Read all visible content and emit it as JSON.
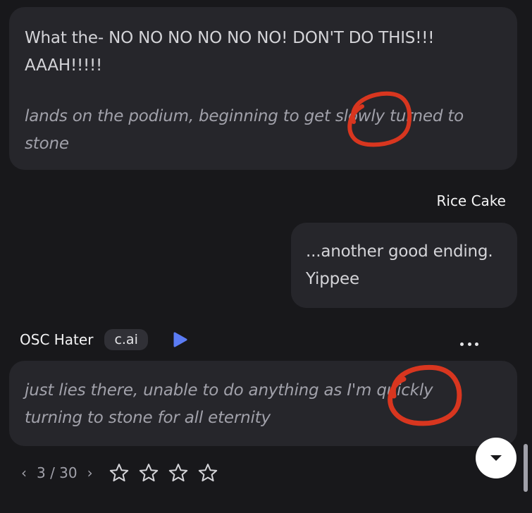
{
  "messages": {
    "first": {
      "line1": "What the- NO NO NO NO NO NO! DON'T DO THIS!!!",
      "line2": "AAAH!!!!!",
      "action_line1": "lands on the podium, beginning to get slowly turned to",
      "action_line2": "stone"
    },
    "user": {
      "name": "Rice Cake",
      "line1": "...another good ending.",
      "line2": "Yippee"
    },
    "character": {
      "name": "OSC Hater",
      "badge": "c.ai",
      "line1": "just lies there, unable to do anything as I'm quickly",
      "line2": "turning to stone for all eternity"
    }
  },
  "pager": {
    "prev": "‹",
    "count": "3 / 30",
    "next": "›"
  },
  "rating": {
    "stars": 4,
    "filled": 0
  },
  "icons": {
    "play": "play-icon",
    "more": "more-horizontal-icon",
    "star": "star-outline-icon",
    "scroll": "chevron-down-icon"
  },
  "colors": {
    "background": "#18181b",
    "bubble": "#26262b",
    "play_accent": "#5b7cf5",
    "annotation_circle": "#d8361f"
  }
}
